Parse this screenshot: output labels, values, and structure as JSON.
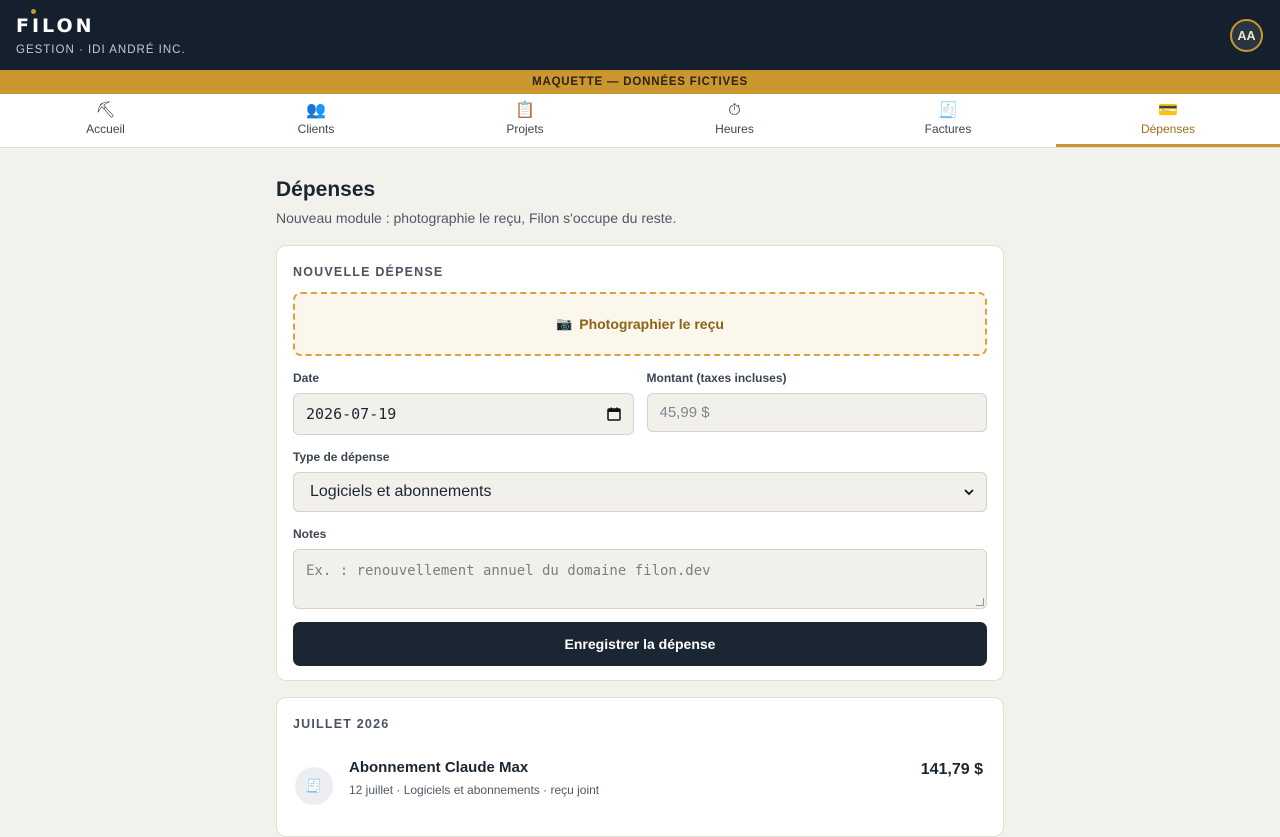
{
  "header": {
    "logo": "FILON",
    "company": "GESTION · IDI ANDRÉ INC.",
    "avatar_initials": "AA"
  },
  "banner": "MAQUETTE — DONNÉES FICTIVES",
  "nav": {
    "items": [
      {
        "label": "Accueil",
        "icon": "⛏"
      },
      {
        "label": "Clients",
        "icon": "👥"
      },
      {
        "label": "Projets",
        "icon": "📋"
      },
      {
        "label": "Heures",
        "icon": "⏱"
      },
      {
        "label": "Factures",
        "icon": "🧾"
      },
      {
        "label": "Dépenses",
        "icon": "💳"
      }
    ],
    "active": "Dépenses"
  },
  "page": {
    "title": "Dépenses",
    "subtitle": "Nouveau module : photographie le reçu, Filon s'occupe du reste."
  },
  "form": {
    "section_title": "NOUVELLE DÉPENSE",
    "photo_button": "Photographier le reçu",
    "date_label": "Date",
    "date_value": "2026-07-19",
    "amount_label": "Montant (taxes incluses)",
    "amount_placeholder": "45,99 $",
    "type_label": "Type de dépense",
    "type_value": "Logiciels et abonnements",
    "notes_label": "Notes",
    "notes_placeholder": "Ex. : renouvellement annuel du domaine filon.dev",
    "submit": "Enregistrer la dépense"
  },
  "list": {
    "month": "JUILLET 2026",
    "items": [
      {
        "name": "Abonnement Claude Max",
        "meta": "12 juillet · Logiciels et abonnements · reçu joint",
        "amount": "141,79 $"
      }
    ]
  },
  "colors": {
    "header_bg": "#15202e",
    "accent": "#c9962f",
    "page_bg": "#f2f1ec",
    "primary_button": "#1b2633"
  }
}
